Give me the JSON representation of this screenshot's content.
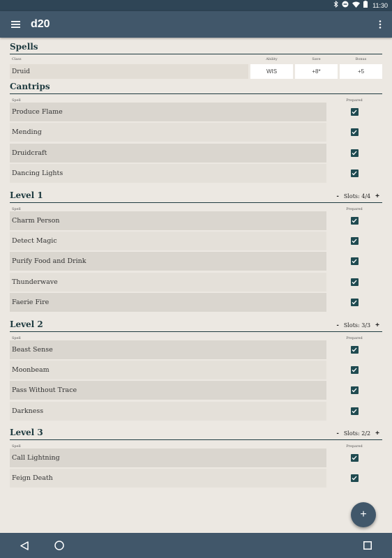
{
  "status_bar": {
    "time": "11:30",
    "icons": [
      "bluetooth-icon",
      "do-not-disturb-icon",
      "wifi-icon",
      "battery-icon"
    ]
  },
  "app_bar": {
    "title": "d20",
    "icons": [
      "menu-icon",
      "more-vert-icon"
    ]
  },
  "spells": {
    "title": "Spells",
    "labels": {
      "class": "Class",
      "ability": "Ability",
      "save": "Save",
      "bonus": "Bonus"
    },
    "class_row": {
      "class": "Druid",
      "ability": "WIS",
      "save": "+8*",
      "bonus": "+5"
    }
  },
  "sections": [
    {
      "title": "Cantrips",
      "slots": null,
      "labels": {
        "spell": "Spell",
        "prepared": "Prepared"
      },
      "spells": [
        {
          "name": "Produce Flame",
          "prepared": true
        },
        {
          "name": "Mending",
          "prepared": true
        },
        {
          "name": "Druidcraft",
          "prepared": true
        },
        {
          "name": "Dancing Lights",
          "prepared": true
        }
      ]
    },
    {
      "title": "Level 1",
      "slots": {
        "minus": "-",
        "text": "Slots: 4/4",
        "plus": "+"
      },
      "labels": {
        "spell": "Spell",
        "prepared": "Prepared"
      },
      "spells": [
        {
          "name": "Charm Person",
          "prepared": true
        },
        {
          "name": "Detect Magic",
          "prepared": true
        },
        {
          "name": "Purify Food and Drink",
          "prepared": true
        },
        {
          "name": "Thunderwave",
          "prepared": true
        },
        {
          "name": "Faerie Fire",
          "prepared": true
        }
      ]
    },
    {
      "title": "Level 2",
      "slots": {
        "minus": "-",
        "text": "Slots: 3/3",
        "plus": "+"
      },
      "labels": {
        "spell": "Spell",
        "prepared": "Prepared"
      },
      "spells": [
        {
          "name": "Beast Sense",
          "prepared": true
        },
        {
          "name": "Moonbeam",
          "prepared": true
        },
        {
          "name": "Pass Without Trace",
          "prepared": true
        },
        {
          "name": "Darkness",
          "prepared": true
        }
      ]
    },
    {
      "title": "Level 3",
      "slots": {
        "minus": "-",
        "text": "Slots: 2/2",
        "plus": "+"
      },
      "labels": {
        "spell": "Spell",
        "prepared": "Prepared"
      },
      "spells": [
        {
          "name": "Call Lightning",
          "prepared": true
        },
        {
          "name": "Feign Death",
          "prepared": true
        }
      ]
    }
  ],
  "fab": {
    "label": "+",
    "icon": "add-icon"
  },
  "nav_bar": {
    "icons": [
      "back-icon",
      "home-icon",
      "recents-icon"
    ]
  },
  "colors": {
    "app_bar": "#41576a",
    "status_bar": "#2f4556",
    "background": "#ece8e2",
    "accent": "#1f4a50"
  }
}
